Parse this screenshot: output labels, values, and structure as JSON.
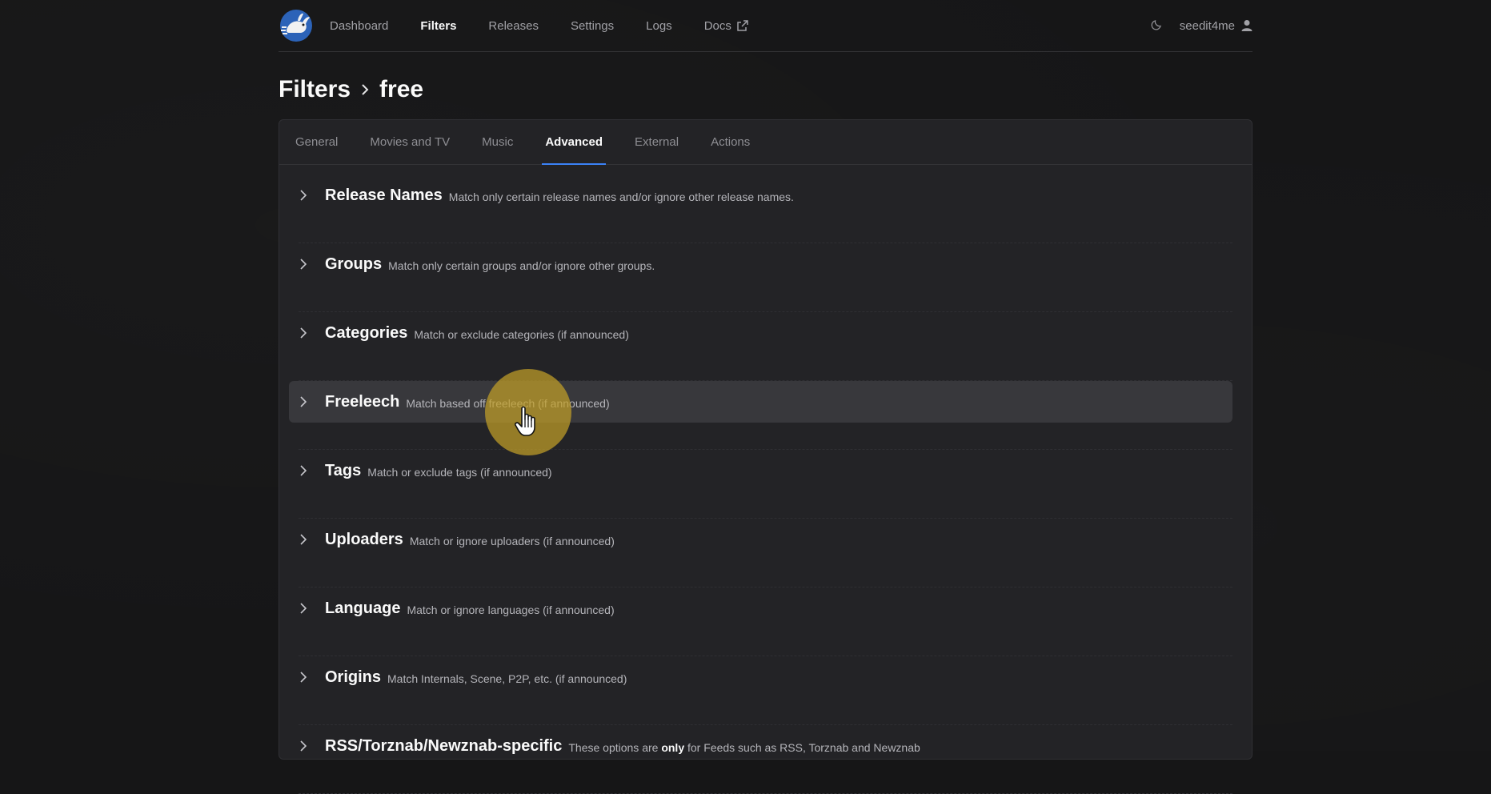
{
  "nav": {
    "links": [
      {
        "label": "Dashboard",
        "active": false
      },
      {
        "label": "Filters",
        "active": true
      },
      {
        "label": "Releases",
        "active": false
      },
      {
        "label": "Settings",
        "active": false
      },
      {
        "label": "Logs",
        "active": false
      },
      {
        "label": "Docs",
        "active": false,
        "external": true
      }
    ],
    "username": "seedit4me",
    "theme_icon": "moon-icon",
    "user_icon": "user-icon"
  },
  "breadcrumb": {
    "root": "Filters",
    "current": "free"
  },
  "tabs": [
    "General",
    "Movies and TV",
    "Music",
    "Advanced",
    "External",
    "Actions"
  ],
  "active_tab": "Advanced",
  "sections": [
    {
      "title": "Release Names",
      "desc": "Match only certain release names and/or ignore other release names."
    },
    {
      "title": "Groups",
      "desc": "Match only certain groups and/or ignore other groups."
    },
    {
      "title": "Categories",
      "desc": "Match or exclude categories (if announced)"
    },
    {
      "title": "Freeleech",
      "desc": "Match based off freeleech (if announced)"
    },
    {
      "title": "Tags",
      "desc": "Match or exclude tags (if announced)"
    },
    {
      "title": "Uploaders",
      "desc": "Match or ignore uploaders (if announced)"
    },
    {
      "title": "Language",
      "desc": "Match or ignore languages (if announced)"
    },
    {
      "title": "Origins",
      "desc": "Match Internals, Scene, P2P, etc. (if announced)"
    },
    {
      "title": "RSS/Torznab/Newznab-specific",
      "desc_pre": "These options are ",
      "desc_bold": "only",
      "desc_post": " for Feeds such as RSS, Torznab and Newznab"
    }
  ],
  "colors": {
    "accent": "#3b82f6",
    "background": "#161617",
    "panel": "#232326",
    "cursor_highlight": "#c2a028"
  }
}
